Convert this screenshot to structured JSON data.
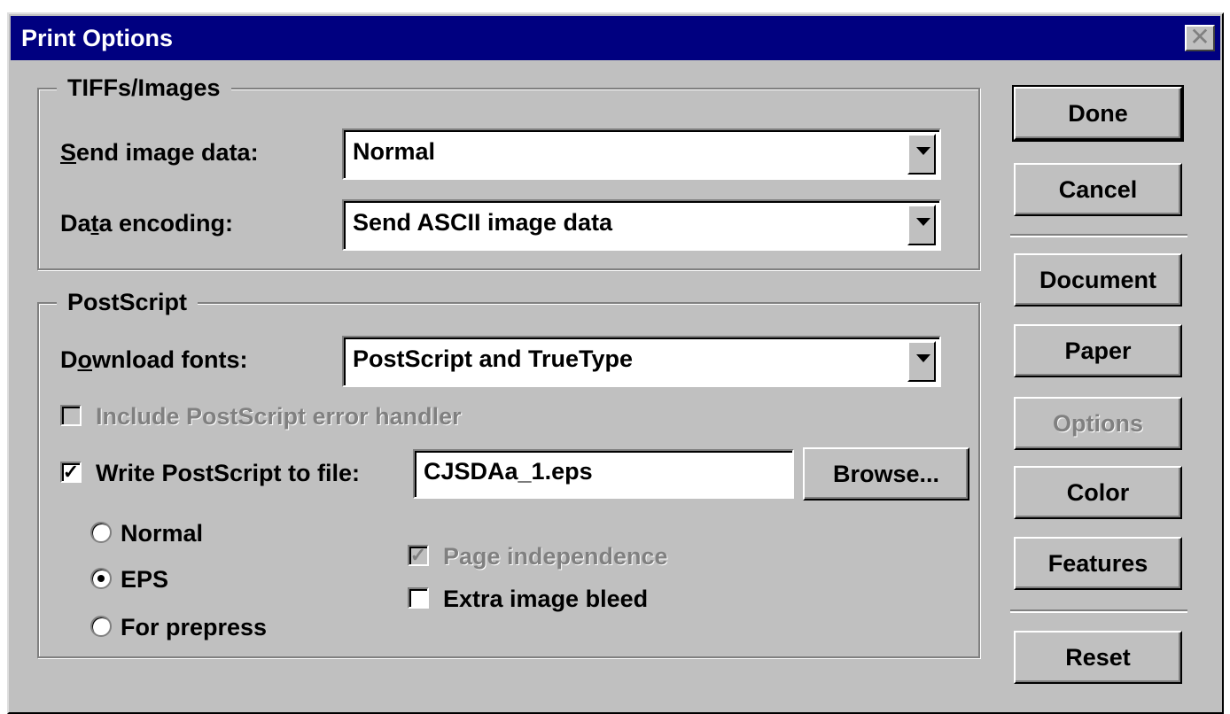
{
  "window": {
    "title": "Print Options",
    "close_glyph": "✕"
  },
  "tiffs_group": {
    "label": "TIFFs/Images",
    "send_image_data_label": "Send image data:",
    "send_image_data_value": "Normal",
    "data_encoding_label": "Data encoding:",
    "data_encoding_value": "Send ASCII image data"
  },
  "postscript_group": {
    "label": "PostScript",
    "download_fonts_label": "Download fonts:",
    "download_fonts_value": "PostScript and TrueType",
    "error_handler_label": "Include PostScript error handler",
    "error_handler_checked": false,
    "write_to_file_label": "Write PostScript to file:",
    "write_to_file_checked": true,
    "file_name": "CJSDAa_1.eps",
    "browse_label": "Browse...",
    "radio_options": [
      "Normal",
      "EPS",
      "For prepress"
    ],
    "radio_selected": "EPS",
    "page_independence_label": "Page independence",
    "page_independence_checked": true,
    "extra_bleed_label": "Extra image bleed",
    "extra_bleed_checked": false
  },
  "buttons": {
    "done": "Done",
    "cancel": "Cancel",
    "document": "Document",
    "paper": "Paper",
    "options": "Options",
    "color": "Color",
    "features": "Features",
    "reset": "Reset"
  },
  "colors": {
    "face": "#c0c0c0",
    "titlebar": "#000080"
  }
}
